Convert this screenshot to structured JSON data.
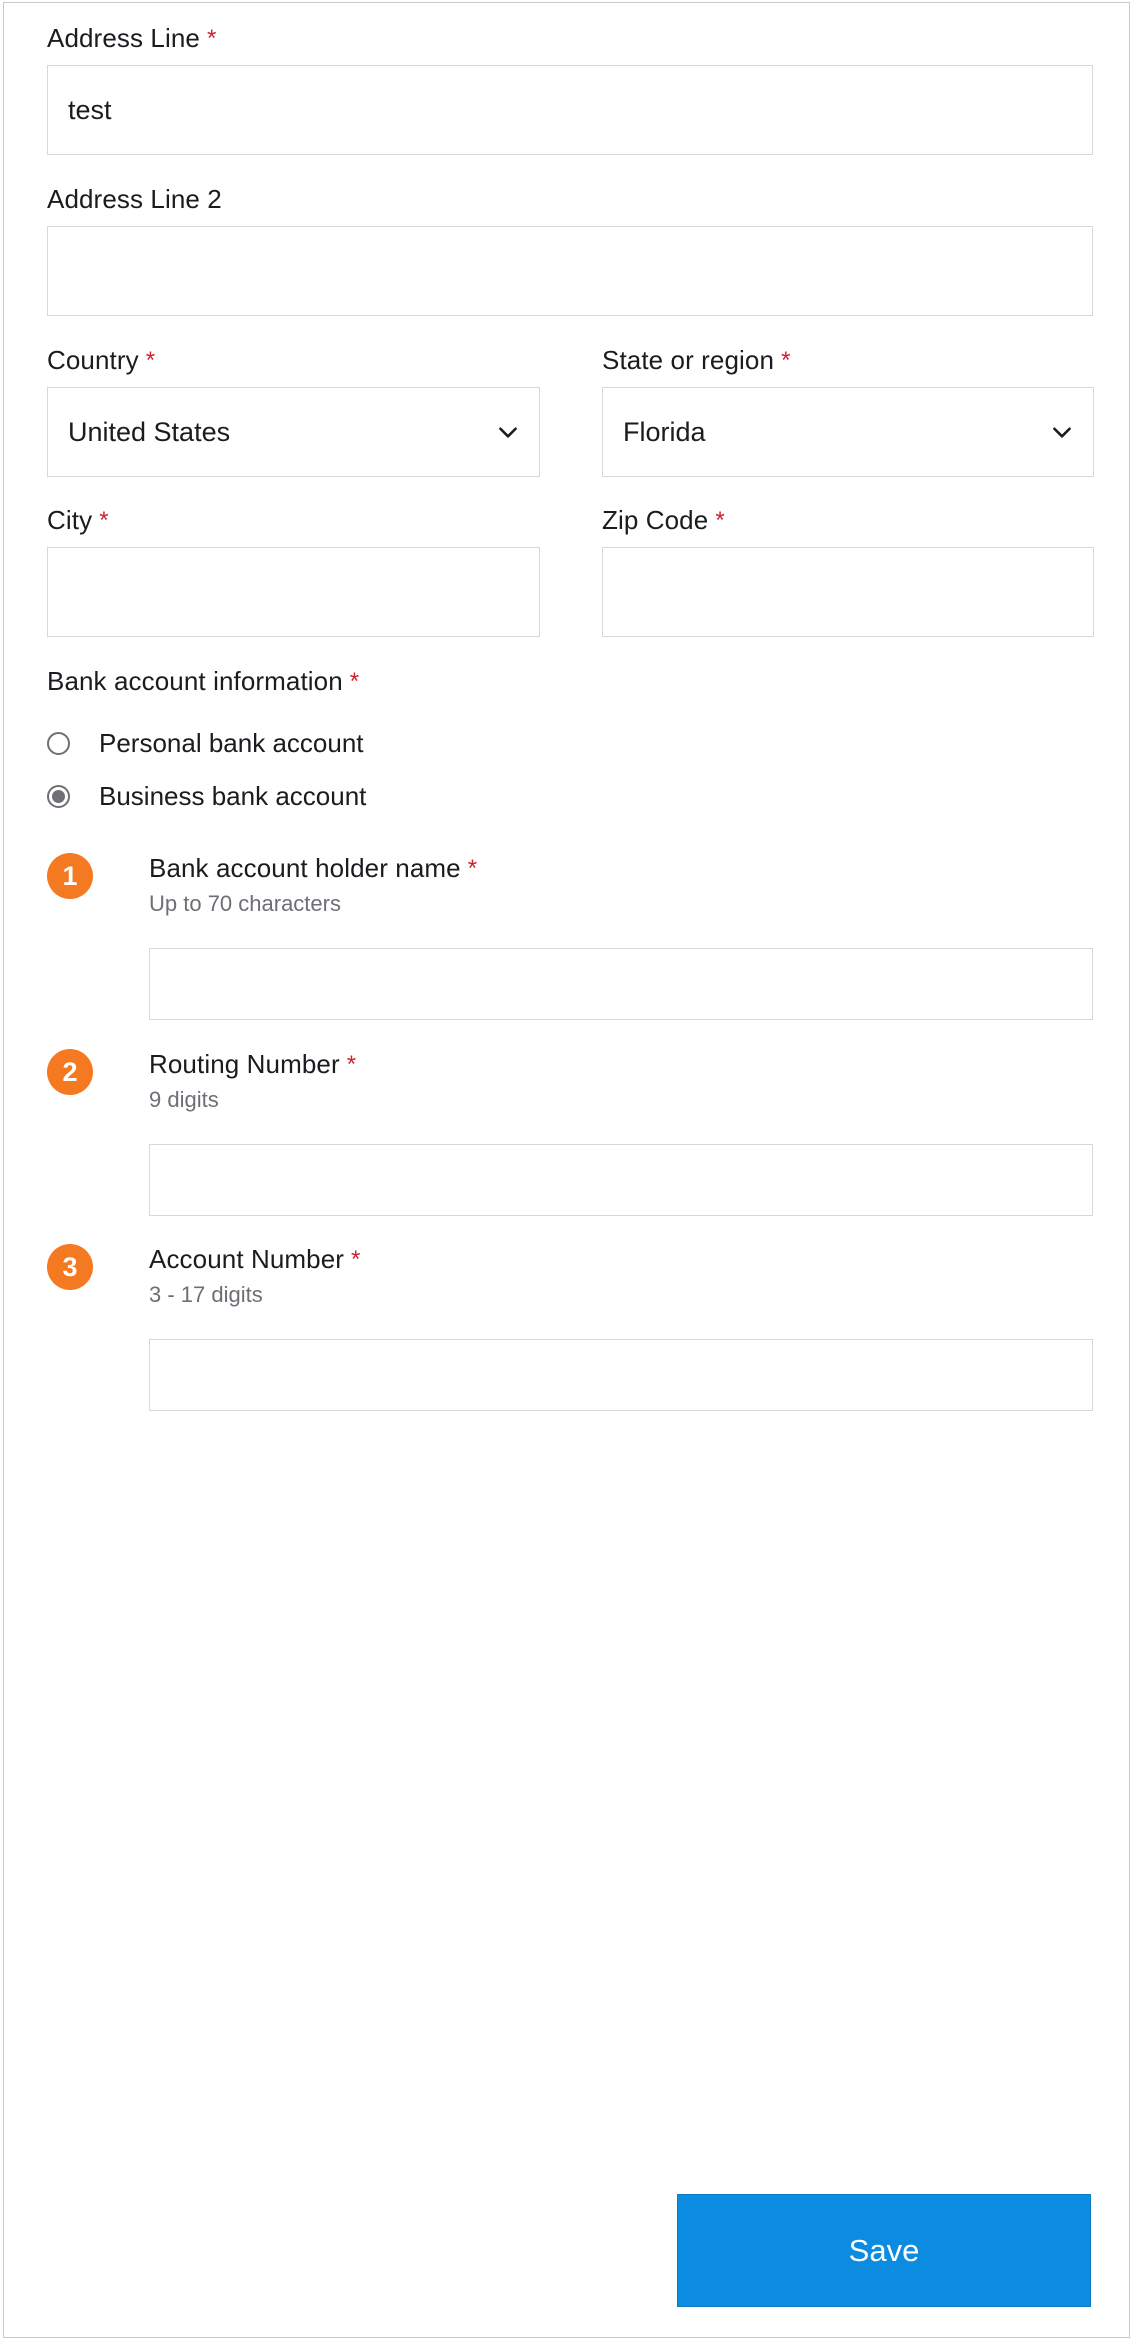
{
  "form": {
    "address_line": {
      "label": "Address Line",
      "required": true,
      "required_mark": "*",
      "value": "test",
      "placeholder": ""
    },
    "address_line_2": {
      "label": "Address Line 2",
      "required": false,
      "value": "",
      "placeholder": ""
    },
    "country": {
      "label": "Country",
      "required": true,
      "required_mark": "*",
      "value": "United States",
      "icon": "chevron-down-icon"
    },
    "state_or_region": {
      "label": "State or region",
      "required": true,
      "required_mark": "*",
      "value": "Florida",
      "icon": "chevron-down-icon"
    },
    "city": {
      "label": "City",
      "required": true,
      "required_mark": "*",
      "value": "",
      "placeholder": ""
    },
    "zip_code": {
      "label": "Zip Code",
      "required": true,
      "required_mark": "*",
      "value": "",
      "placeholder": ""
    },
    "bank_account_information": {
      "label": "Bank account information",
      "required": true,
      "required_mark": "*",
      "options": [
        {
          "label": "Personal bank account",
          "selected": false
        },
        {
          "label": "Business bank account",
          "selected": true
        }
      ]
    },
    "numbered_fields": [
      {
        "number": "1",
        "label": "Bank account holder name",
        "required_mark": "*",
        "hint": "Up to 70 characters",
        "value": "",
        "placeholder": ""
      },
      {
        "number": "2",
        "label": "Routing Number",
        "required_mark": "*",
        "hint": "9 digits",
        "value": "",
        "placeholder": ""
      },
      {
        "number": "3",
        "label": "Account Number",
        "required_mark": "*",
        "hint": "3 - 17 digits",
        "value": "",
        "placeholder": ""
      }
    ],
    "save_button": {
      "label": "Save"
    }
  },
  "colors": {
    "required_asterisk": "#d0202e",
    "badge_orange": "#f47920",
    "save_blue": "#0c8ce0",
    "border_gray": "#d8d8d8",
    "hint_gray": "#6e6e76",
    "text_dark": "#1b1b20"
  }
}
